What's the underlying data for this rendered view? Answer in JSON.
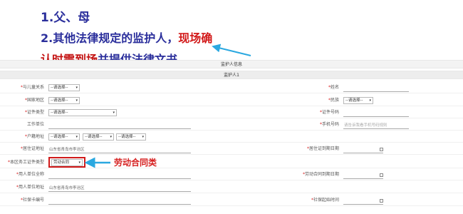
{
  "annotations": {
    "line1": "1.父、母",
    "line2_prefix": "2.其他法律规定的监护人，",
    "line2_red": "现场确",
    "line3_red": "认时需到场",
    "line3_navy": "并提供法律文书。",
    "labor_contract_callout": "劳动合同类"
  },
  "form": {
    "section_title": "监护人信息",
    "guardian_header": "监护人1",
    "select_placeholder": "--请选择--",
    "fields": {
      "relation": {
        "label": "与儿童关系"
      },
      "name": {
        "label": "姓名"
      },
      "country": {
        "label": "国家地区"
      },
      "ethnicity": {
        "label": "民族"
      },
      "id_type": {
        "label": "证件类型"
      },
      "id_number": {
        "label": "证件号码"
      },
      "work_unit": {
        "label": "工作单位"
      },
      "mobile": {
        "label": "手机号码",
        "placeholder": "请告诉我看手机号码规则"
      },
      "hukou": {
        "label": "户籍地址"
      },
      "residence": {
        "label": "居住证地址",
        "value": "山东省青岛市李沧区"
      },
      "residence_date": {
        "label": "居住证到期日期"
      },
      "employment_cert": {
        "label": "本区务工证件类型",
        "value": "劳动合同"
      },
      "employer_name": {
        "label": "用人单位全称"
      },
      "contract_expiry": {
        "label": "劳动合同到期日期"
      },
      "employer_address": {
        "label": "用人单位地址",
        "value": "山东省青岛市李沧区"
      },
      "social_security_no": {
        "label": "社保卡编号"
      },
      "social_security_start": {
        "label": "社保起始时间"
      }
    }
  },
  "colors": {
    "annotation_navy": "#2b2f9c",
    "annotation_red": "#d21a1a",
    "arrow_blue": "#2aa8e0",
    "highlight_box": "#d11a1a"
  }
}
